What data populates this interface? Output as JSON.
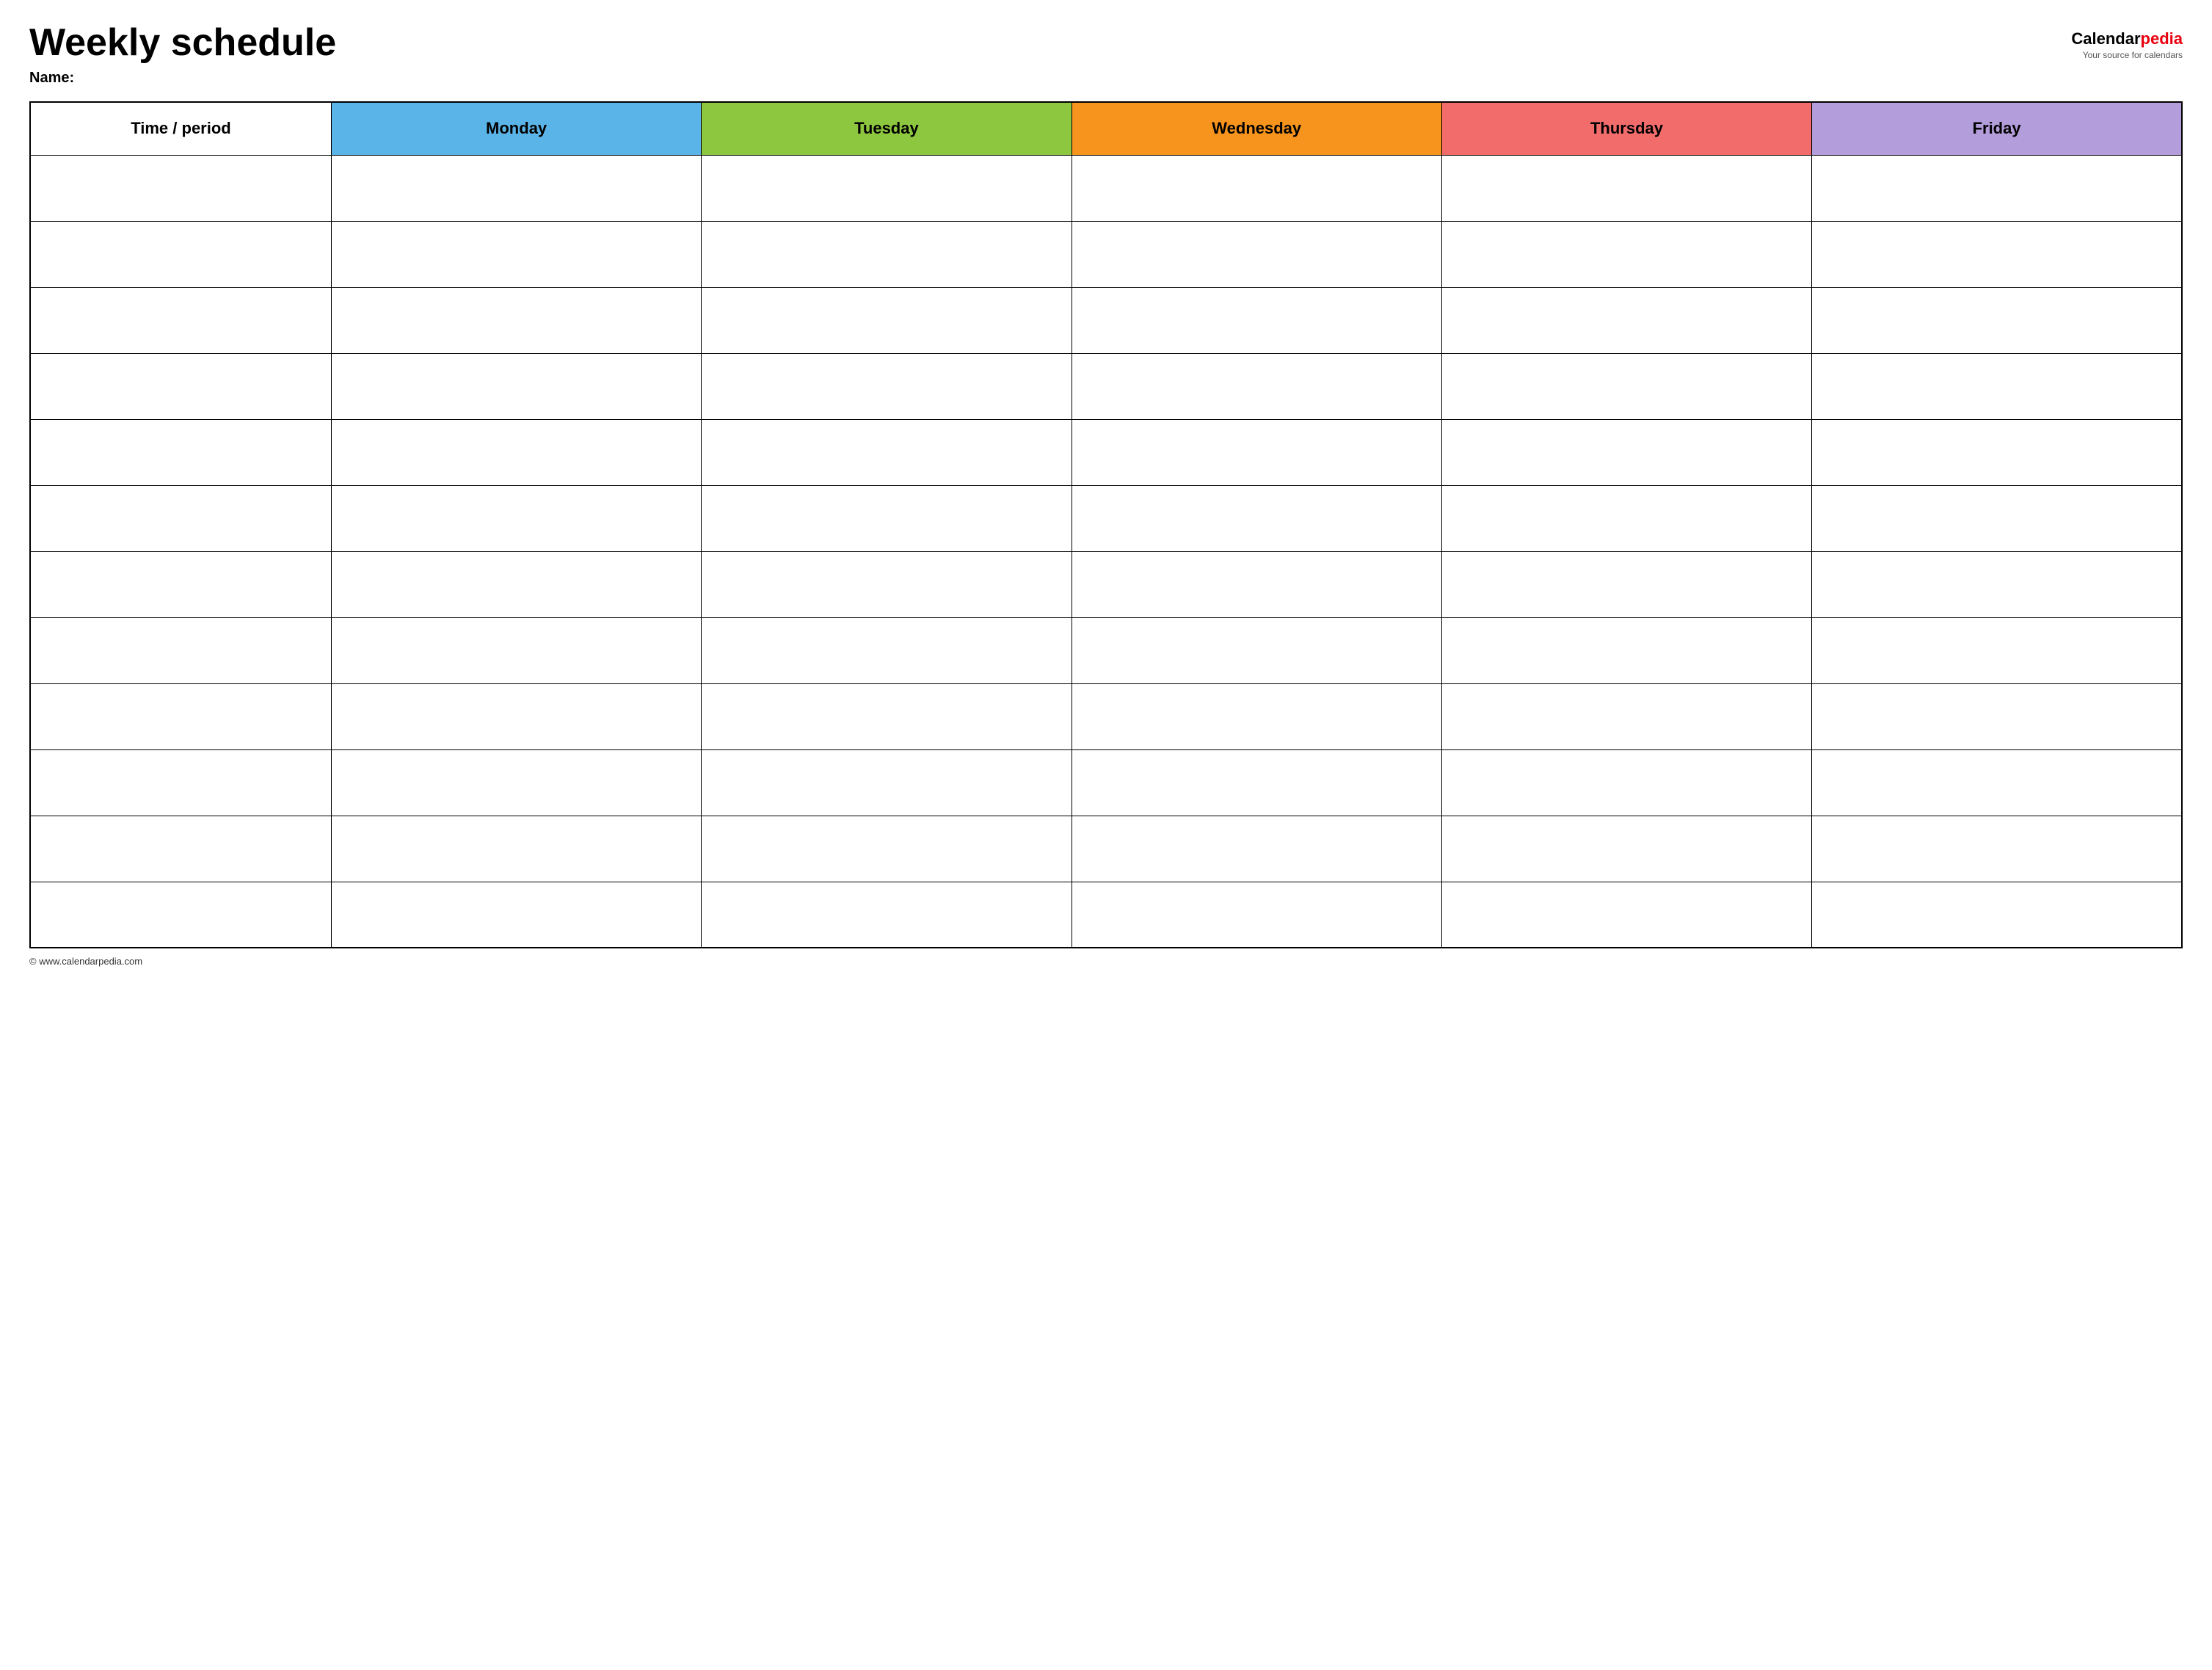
{
  "header": {
    "title": "Weekly schedule",
    "name_label": "Name:",
    "logo": {
      "calendar_part": "Calendar",
      "pedia_part": "pedia",
      "tagline": "Your source for calendars"
    }
  },
  "table": {
    "columns": [
      {
        "key": "time",
        "label": "Time / period",
        "color": "#ffffff"
      },
      {
        "key": "monday",
        "label": "Monday",
        "color": "#5ab4e8"
      },
      {
        "key": "tuesday",
        "label": "Tuesday",
        "color": "#8dc63f"
      },
      {
        "key": "wednesday",
        "label": "Wednesday",
        "color": "#f7941d"
      },
      {
        "key": "thursday",
        "label": "Thursday",
        "color": "#f26c6c"
      },
      {
        "key": "friday",
        "label": "Friday",
        "color": "#b39ddb"
      }
    ],
    "row_count": 12
  },
  "footer": {
    "url": "© www.calendarpedia.com"
  }
}
